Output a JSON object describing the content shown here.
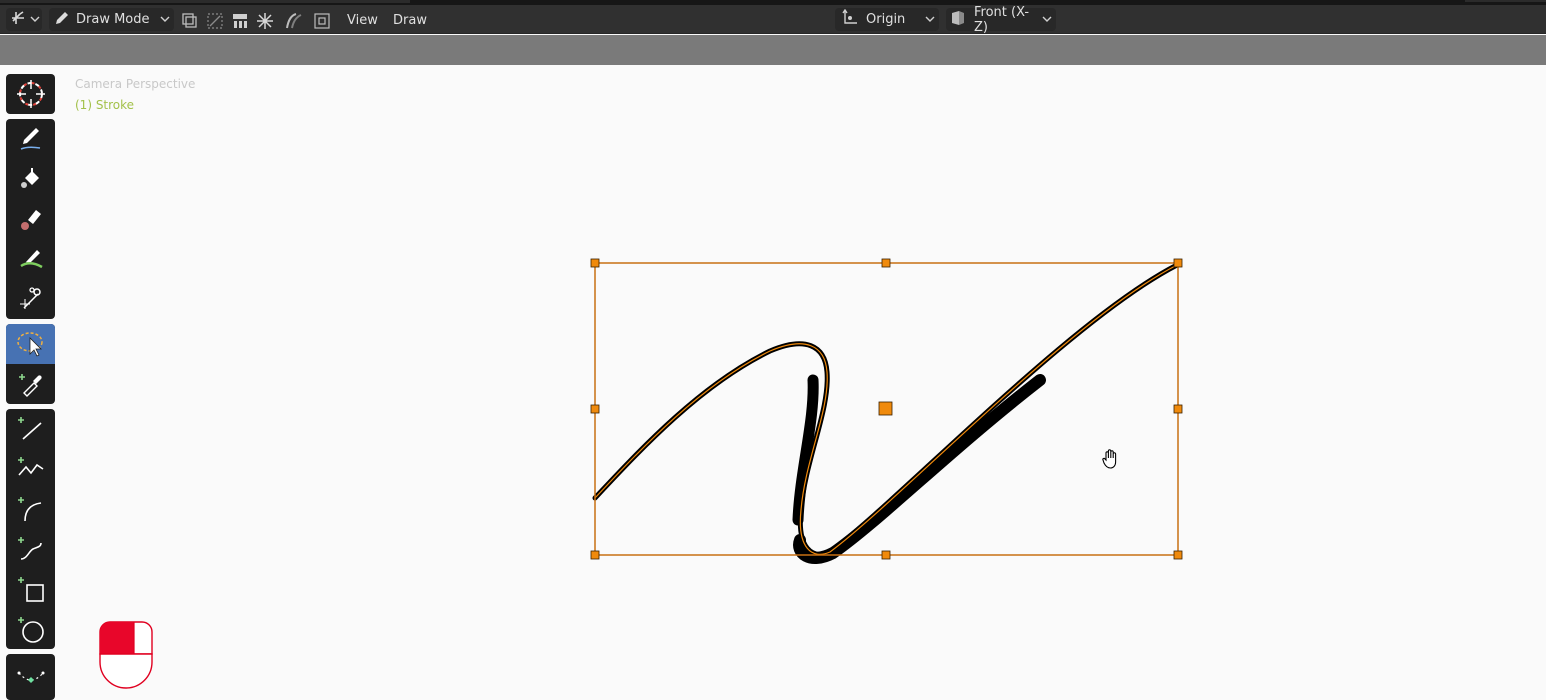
{
  "header": {
    "editor_type_icon": "grease-pencil-editor-icon",
    "mode_label": "Draw Mode",
    "mode_icon": "pencil-icon",
    "toggle_icons": [
      "multiframe-icon",
      "curve-edit-icon",
      "weight-icon",
      "onion-skin-icon",
      "stroke-placement-icon",
      "guide-icon"
    ],
    "menus": [
      "View",
      "Draw"
    ],
    "origin_label": "Origin",
    "origin_icon": "transform-pivot-icon",
    "view_label": "Front (X-Z)",
    "view_icon": "drawing-plane-icon"
  },
  "viewport": {
    "camera_text": "Camera Perspective",
    "object_text": "(1) Stroke",
    "camera_text_color": "#c8c8c8",
    "object_text_color": "#a3c14a",
    "selection_color": "#f08a0c",
    "stroke_color": "#000000"
  },
  "toolbar": {
    "groups": [
      [
        "cursor-icon"
      ],
      [
        "draw-icon",
        "fill-icon",
        "erase-icon",
        "tint-icon",
        "cutter-icon"
      ],
      [
        "select-box-icon",
        "eyedropper-icon"
      ],
      [
        "line-icon",
        "polyline-icon",
        "arc-icon",
        "curve-icon",
        "box-icon",
        "circle-icon"
      ],
      [
        "interpolate-icon"
      ]
    ],
    "active_tool": "select-box-icon"
  },
  "status_icons": {
    "mouse": "mouse-left-click-icon",
    "cursor": "hand-grab-cursor-icon"
  }
}
